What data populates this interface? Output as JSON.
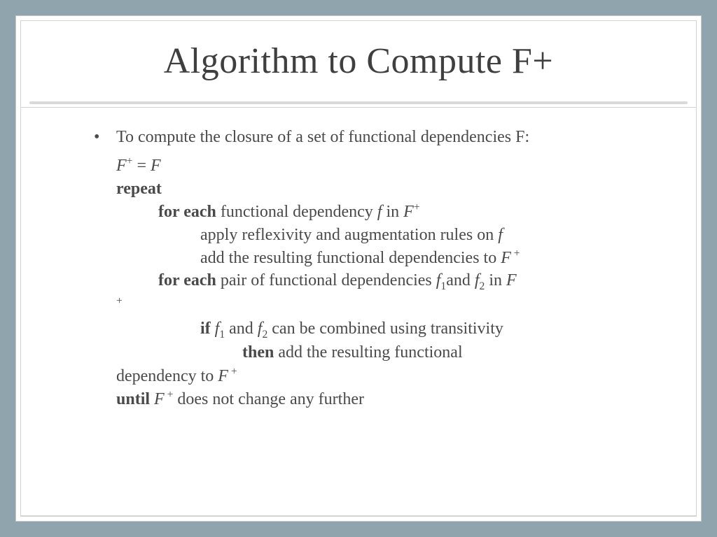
{
  "title": "Algorithm to Compute F+",
  "bullet": "To compute the closure of a set of functional dependencies F:",
  "algo": {
    "init_lhs": "F",
    "init_sup": "+",
    "init_eq": " = ",
    "init_rhs": "F",
    "repeat": "repeat",
    "foreach1_kw": "for each",
    "foreach1_txt1": " functional dependency ",
    "foreach1_f": "f ",
    "foreach1_in": "in ",
    "foreach1_F": "F",
    "foreach1_sup": "+",
    "apply": " apply reflexivity and augmentation rules on ",
    "apply_f": "f",
    "add1_txt": " add the resulting functional dependencies to ",
    "add1_F": "F",
    "add1_sup": " +",
    "foreach2_kw": "for each",
    "foreach2_txt1": " pair of functional dependencies ",
    "foreach2_f1": "f",
    "foreach2_s1": "1",
    "foreach2_and": "and ",
    "foreach2_f2": "f",
    "foreach2_s2": "2",
    "foreach2_in": " in ",
    "foreach2_F": "F",
    "hang_sup": "+",
    "if_kw": "if ",
    "if_f1": "f",
    "if_s1": "1",
    "if_and": " and ",
    "if_f2": "f",
    "if_s2": "2",
    "if_txt": " can be combined using transitivity",
    "then_kw": "then",
    "then_txt": " add the resulting functional",
    "dep_txt": "dependency to ",
    "dep_F": "F",
    "dep_sup": " +",
    "until_kw": "until ",
    "until_F": "F",
    "until_sup": " +",
    "until_txt": " does not change any further"
  }
}
